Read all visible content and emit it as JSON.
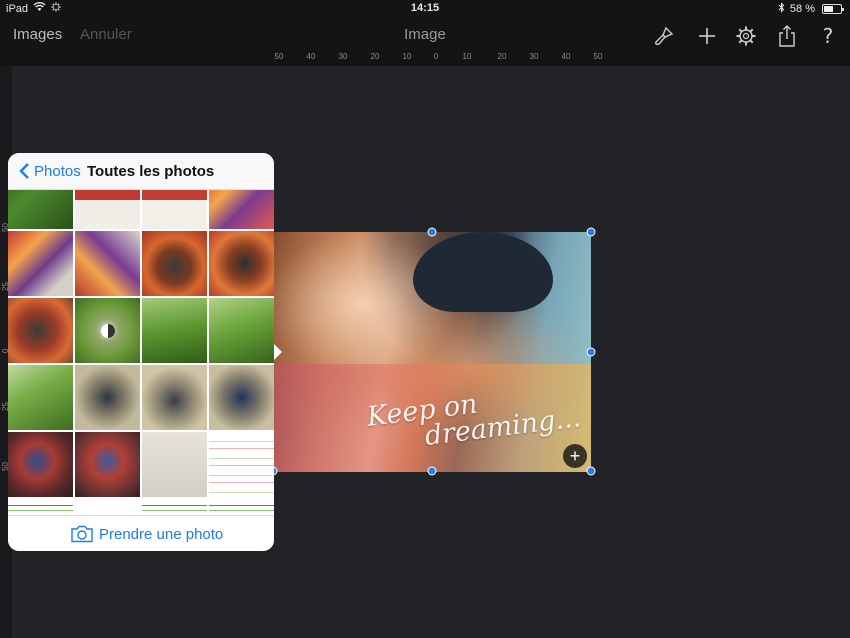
{
  "status_bar": {
    "device": "iPad",
    "time": "14:15",
    "battery": "58 %",
    "battery_level": 0.58
  },
  "navbar": {
    "images_label": "Images",
    "cancel_label": "Annuler",
    "title": "Image",
    "icons": [
      "brush-icon",
      "plus-icon",
      "gear-icon",
      "share-icon",
      "help-icon"
    ]
  },
  "ruler_top": [
    "50",
    "40",
    "30",
    "20",
    "10",
    "0",
    "10",
    "20",
    "30",
    "40",
    "50"
  ],
  "ruler_left": [
    "50",
    "25",
    "0",
    "25",
    "50"
  ],
  "canvas_image": {
    "caption_line1": "Keep on",
    "caption_line2": "dreaming..."
  },
  "popover": {
    "back_label": "Photos",
    "title": "Toutes les photos",
    "take_photo_label": "Prendre une photo"
  },
  "colors": {
    "accent": "#1a7cf5",
    "handle": "#2a7fe0",
    "toolbar": "#141414",
    "canvas": "#222326"
  }
}
